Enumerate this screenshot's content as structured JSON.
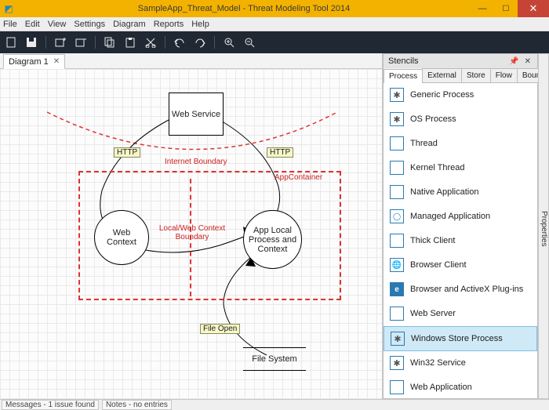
{
  "window": {
    "title": "SampleApp_Threat_Model - Threat Modeling Tool 2014"
  },
  "menu": [
    "File",
    "Edit",
    "View",
    "Settings",
    "Diagram",
    "Reports",
    "Help"
  ],
  "doc_tabs": [
    {
      "label": "Diagram 1"
    }
  ],
  "stencil_panel": {
    "title": "Stencils",
    "tabs": [
      "Process",
      "External",
      "Store",
      "Flow",
      "Boundary"
    ],
    "active_tab": 0,
    "properties_tab": "Properties",
    "items": [
      {
        "label": "Generic Process",
        "icon": "gear",
        "selected": false
      },
      {
        "label": "OS Process",
        "icon": "gear",
        "selected": false
      },
      {
        "label": "Thread",
        "icon": "plain",
        "selected": false
      },
      {
        "label": "Kernel Thread",
        "icon": "plain",
        "selected": false
      },
      {
        "label": "Native Application",
        "icon": "plain",
        "selected": false
      },
      {
        "label": "Managed Application",
        "icon": "circ",
        "selected": false
      },
      {
        "label": "Thick Client",
        "icon": "plain",
        "selected": false
      },
      {
        "label": "Browser Client",
        "icon": "globe",
        "selected": false
      },
      {
        "label": "Browser and ActiveX Plug-ins",
        "icon": "e",
        "selected": false
      },
      {
        "label": "Web Server",
        "icon": "plain",
        "selected": false
      },
      {
        "label": "Windows Store Process",
        "icon": "gear",
        "selected": true
      },
      {
        "label": "Win32 Service",
        "icon": "gear",
        "selected": false
      },
      {
        "label": "Web Application",
        "icon": "plain",
        "selected": false
      }
    ]
  },
  "diagram": {
    "shapes": {
      "web_service": "Web Service",
      "web_context": "Web Context",
      "app_local": "App Local Process and Context",
      "file_system": "File System"
    },
    "tags": {
      "http_left": "HTTP",
      "http_right": "HTTP",
      "file_open": "File Open"
    },
    "boundaries": {
      "internet": "Internet Boundary",
      "localweb": "Local/Web Context Boundary",
      "appcontainer": "AppContainer"
    }
  },
  "status": {
    "messages": "Messages - 1 issue found",
    "notes": "Notes - no entries"
  }
}
